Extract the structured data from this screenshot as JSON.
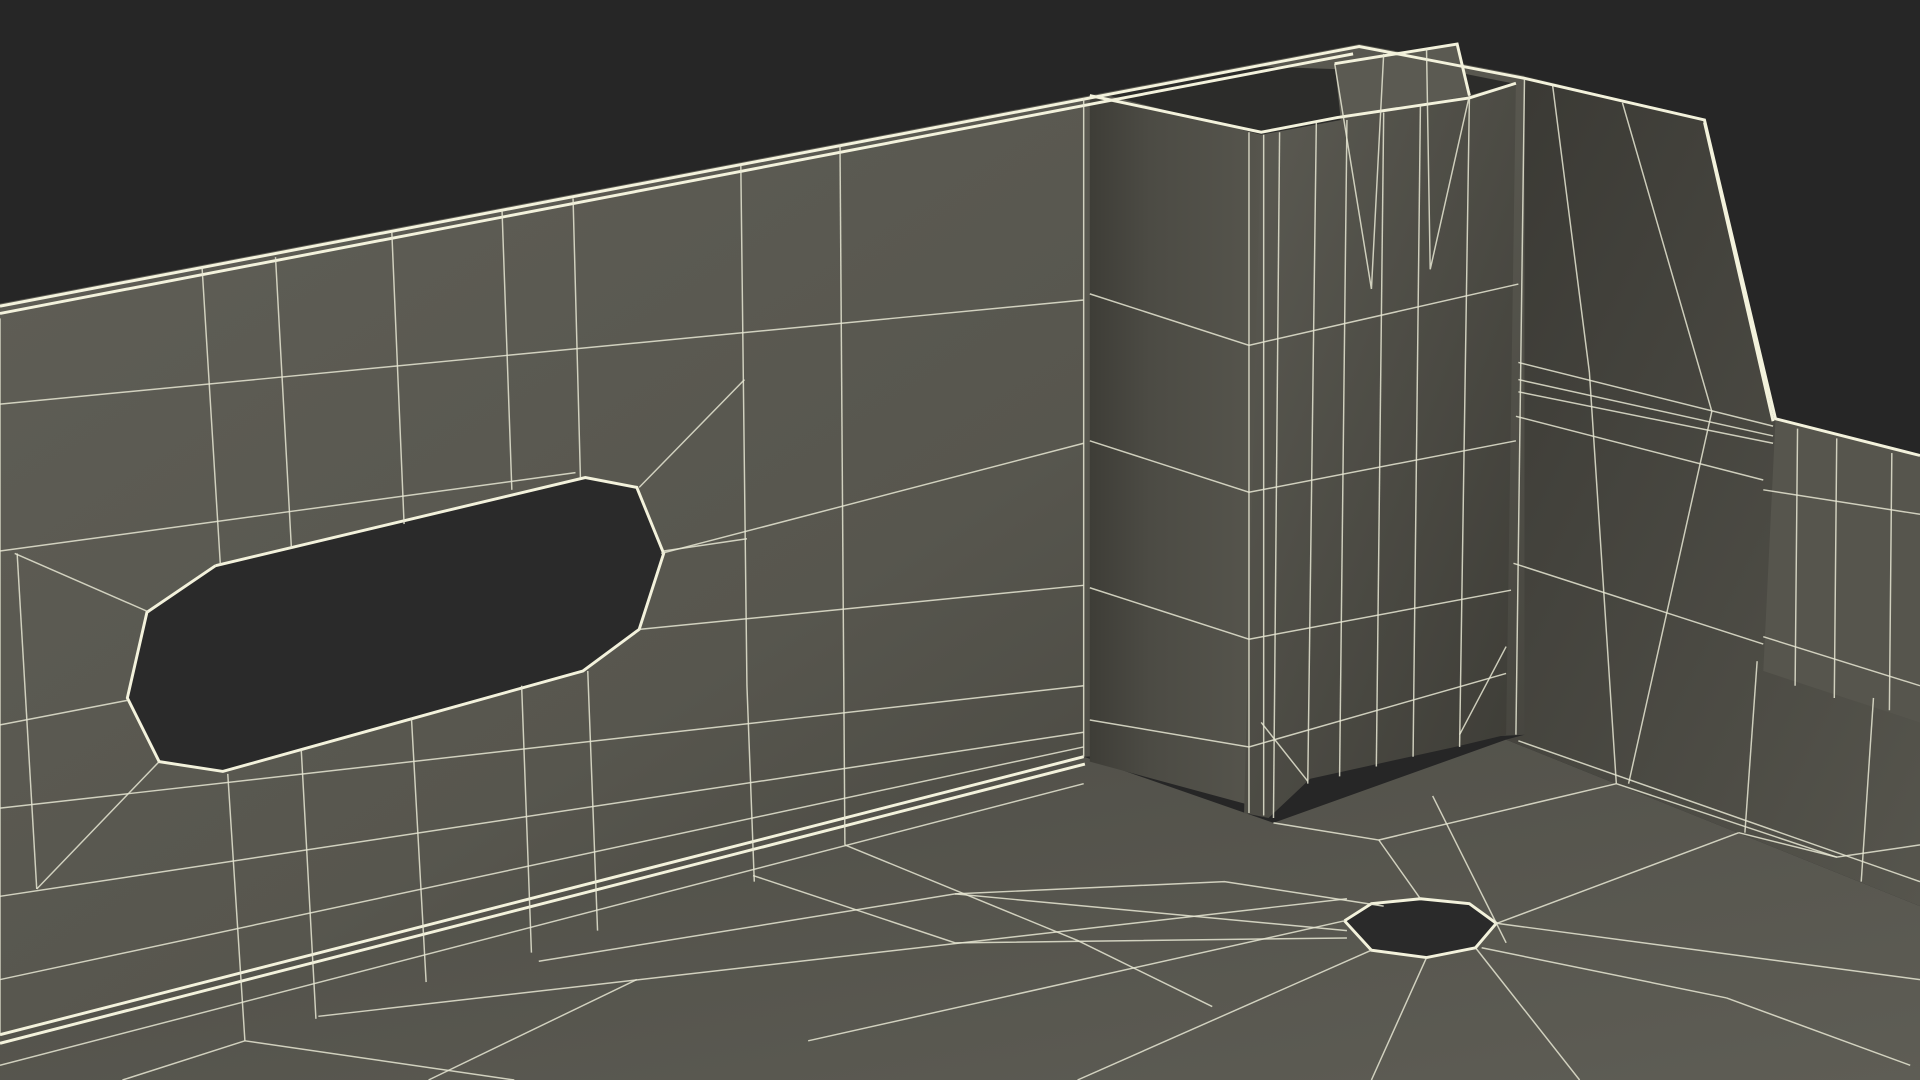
{
  "viewport": {
    "background": "#262626",
    "content": "wireframe-render",
    "colors": {
      "wall_light": "#5e5d55",
      "wall_dark": "#3d3c36",
      "floor": "#55554d",
      "wire": "#e6e6d2",
      "cutout": "#2a2a2a"
    }
  }
}
